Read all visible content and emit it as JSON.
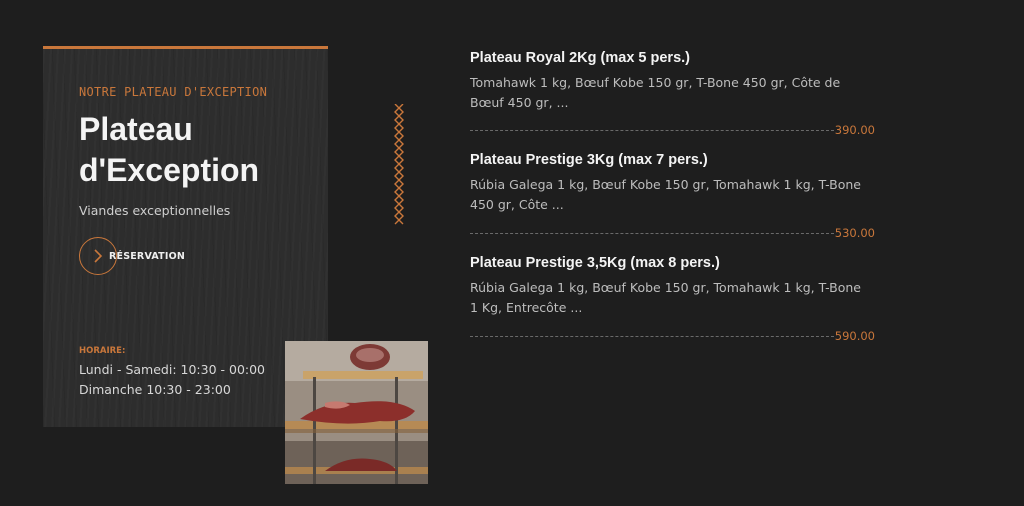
{
  "card": {
    "eyebrow": "NOTRE PLATEAU D'EXCEPTION",
    "title": "Plateau d'Exception",
    "subtitle": "Viandes exceptionnelles",
    "reservation_label": "RÉSERVATION",
    "hours_label": "HORAIRE:",
    "hours_line_1": "Lundi - Samedi: 10:30 - 00:00",
    "hours_line_2": "Dimanche 10:30 - 23:00"
  },
  "menu": [
    {
      "title": "Plateau Royal 2Kg (max 5 pers.)",
      "description": "Tomahawk 1 kg, Bœuf Kobe 150 gr, T-Bone 450 gr, Côte de Bœuf 450 gr, ...",
      "price": "390.00"
    },
    {
      "title": "Plateau Prestige 3Kg (max 7 pers.)",
      "description": "Rúbia Galega 1 kg, Bœuf Kobe 150 gr, Tomahawk 1 kg, T-Bone 450 gr, Côte ...",
      "price": "530.00"
    },
    {
      "title": "Plateau Prestige 3,5Kg (max 8 pers.)",
      "description": "Rúbia Galega 1 kg, Bœuf Kobe 150 gr, Tomahawk 1 kg, T-Bone 1 Kg, Entrecôte ...",
      "price": "590.00"
    }
  ],
  "colors": {
    "accent": "#c9773b",
    "background": "#1e1e1e",
    "card": "#2d2d2d"
  },
  "icons": {
    "reservation": "chevron-right-icon",
    "divider": "zigzag-ornament-icon"
  }
}
